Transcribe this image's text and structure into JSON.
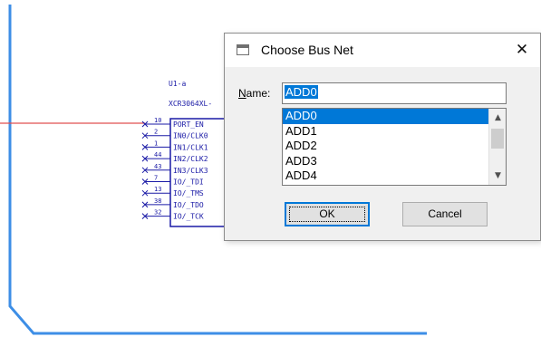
{
  "schematic": {
    "part": {
      "ref": "U1-a",
      "type": "XCR3064XL-"
    },
    "pins": [
      {
        "num": "10",
        "name": "PORT_EN"
      },
      {
        "num": "2",
        "name": "IN0/CLK0"
      },
      {
        "num": "1",
        "name": "IN1/CLK1"
      },
      {
        "num": "44",
        "name": "IN2/CLK2"
      },
      {
        "num": "43",
        "name": "IN3/CLK3"
      },
      {
        "num": "7",
        "name": "IO/_TDI"
      },
      {
        "num": "13",
        "name": "IO/_TMS"
      },
      {
        "num": "38",
        "name": "IO/_TDO"
      },
      {
        "num": "32",
        "name": "IO/_TCK"
      }
    ],
    "colors": {
      "bus": "#3d8ee6",
      "wire": "#e05050",
      "symbol": "#1a1aa6"
    }
  },
  "dialog": {
    "title": "Choose Bus Net",
    "close_glyph": "✕",
    "name_label_mnemonic": "N",
    "name_label_rest": "ame:",
    "name_value": "ADD0",
    "list_items": [
      "ADD0",
      "ADD1",
      "ADD2",
      "ADD3",
      "ADD4"
    ],
    "selected_item": "ADD0",
    "ok_label": "OK",
    "cancel_label": "Cancel",
    "scroll_up_glyph": "▲",
    "scroll_down_glyph": "▼",
    "colors": {
      "selection": "#0078d7",
      "background": "#f0f0f0"
    }
  }
}
